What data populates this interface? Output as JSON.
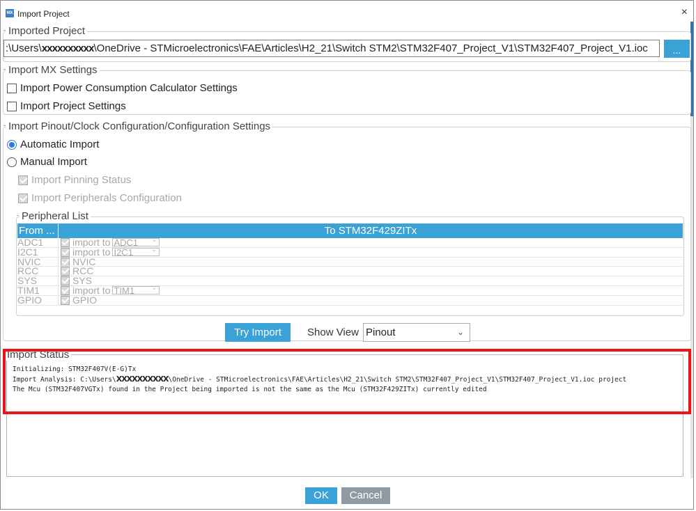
{
  "window": {
    "icon_text": "MX",
    "title": "Import Project",
    "close_glyph": "×"
  },
  "imported_project": {
    "legend": "Imported Project",
    "path_prefix": ":\\Users\\",
    "path_redacted": "XXXXXXXXXX",
    "path_suffix": "\\OneDrive - STMicroelectronics\\FAE\\Articles\\H2_21\\Switch STM2\\STM32F407_Project_V1\\STM32F407_Project_V1.ioc",
    "browse_label": "..."
  },
  "mx_settings": {
    "legend": "Import MX Settings",
    "options": [
      {
        "label": "Import Power Consumption Calculator Settings",
        "checked": false
      },
      {
        "label": "Import Project Settings",
        "checked": false
      }
    ]
  },
  "pinout_settings": {
    "legend": "Import Pinout/Clock Configuration/Configuration Settings",
    "automatic_label": "Automatic Import",
    "manual_label": "Manual Import",
    "selected": "automatic",
    "pinning_status_label": "Import Pinning Status",
    "peripherals_config_label": "Import Peripherals Configuration"
  },
  "peripheral_list": {
    "legend": "Peripheral List",
    "col_from": "From ...",
    "col_to": "To STM32F429ZITx",
    "rows": [
      {
        "from": "ADC1",
        "action": "import to",
        "target": "ADC1"
      },
      {
        "from": "I2C1",
        "action": "import to",
        "target": "I2C1"
      },
      {
        "from": "NVIC",
        "action": "NVIC",
        "target": ""
      },
      {
        "from": "RCC",
        "action": "RCC",
        "target": ""
      },
      {
        "from": "SYS",
        "action": "SYS",
        "target": ""
      },
      {
        "from": "TIM1",
        "action": "import to",
        "target": "TIM1"
      },
      {
        "from": "GPIO",
        "action": "GPIO",
        "target": ""
      }
    ]
  },
  "actions": {
    "try_import": "Try Import",
    "show_view_label": "Show View",
    "show_view_value": "Pinout"
  },
  "import_status": {
    "legend": "Import Status",
    "line1": "Initializing: STM32F407V(E-G)Tx",
    "line2_prefix": "Import Analysis: C:\\Users\\",
    "line2_redacted": "XXXXXXXXXX",
    "line2_suffix": "\\OneDrive - STMicroelectronics\\FAE\\Articles\\H2_21\\Switch STM2\\STM32F407_Project_V1\\STM32F407_Project_V1.ioc project",
    "line3": "The Mcu (STM32F407VGTx) found in the Project being imported is not the same as the Mcu (STM32F429ZITx) currently edited"
  },
  "footer": {
    "ok": "OK",
    "cancel": "Cancel"
  },
  "colors": {
    "accent": "#3ba2d8",
    "highlight": "#e8141a",
    "cancel": "#8f9aa3"
  }
}
